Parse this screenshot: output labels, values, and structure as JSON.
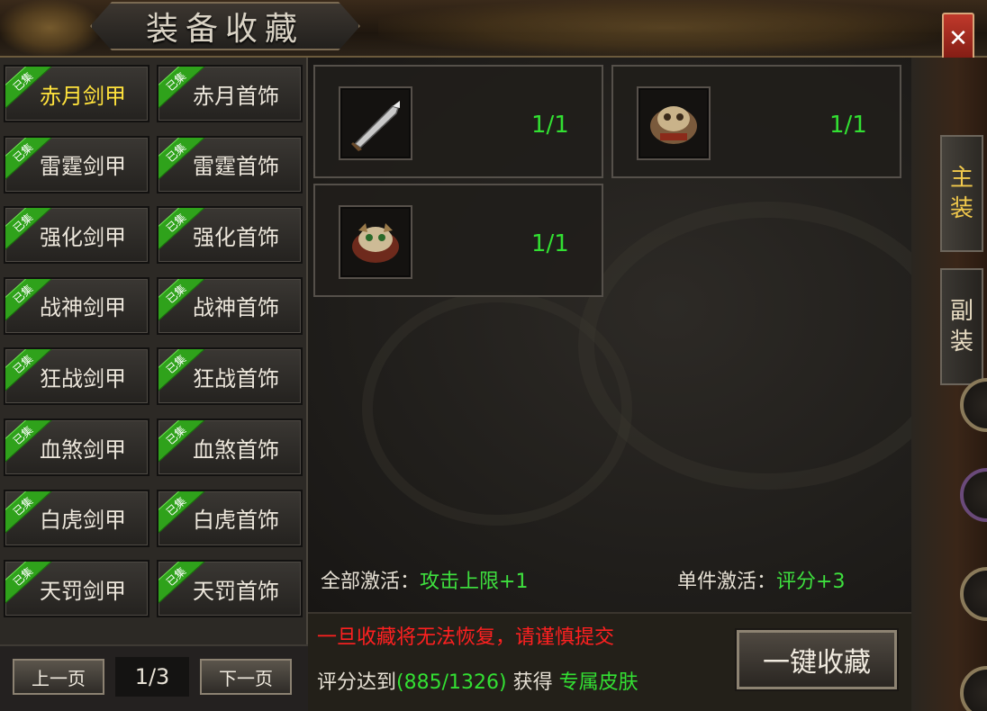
{
  "window": {
    "title": "装备收藏",
    "close_label": "✕"
  },
  "side_tabs": [
    {
      "label": "主装",
      "active": true
    },
    {
      "label": "副装",
      "active": false
    }
  ],
  "items": [
    {
      "name": "赤月剑甲",
      "tag": "已集",
      "active": true
    },
    {
      "name": "赤月首饰",
      "tag": "已集",
      "active": false
    },
    {
      "name": "雷霆剑甲",
      "tag": "已集",
      "active": false
    },
    {
      "name": "雷霆首饰",
      "tag": "已集",
      "active": false
    },
    {
      "name": "强化剑甲",
      "tag": "已集",
      "active": false
    },
    {
      "name": "强化首饰",
      "tag": "已集",
      "active": false
    },
    {
      "name": "战神剑甲",
      "tag": "已集",
      "active": false
    },
    {
      "name": "战神首饰",
      "tag": "已集",
      "active": false
    },
    {
      "name": "狂战剑甲",
      "tag": "已集",
      "active": false
    },
    {
      "name": "狂战首饰",
      "tag": "已集",
      "active": false
    },
    {
      "name": "血煞剑甲",
      "tag": "已集",
      "active": false
    },
    {
      "name": "血煞首饰",
      "tag": "已集",
      "active": false
    },
    {
      "name": "白虎剑甲",
      "tag": "已集",
      "active": false
    },
    {
      "name": "白虎首饰",
      "tag": "已集",
      "active": false
    },
    {
      "name": "天罚剑甲",
      "tag": "已集",
      "active": false
    },
    {
      "name": "天罚首饰",
      "tag": "已集",
      "active": false
    }
  ],
  "pager": {
    "prev_label": "上一页",
    "page": "1/3",
    "next_label": "下一页"
  },
  "slots": [
    {
      "icon": "sword-icon",
      "count": "1/1"
    },
    {
      "icon": "armor-icon",
      "count": "1/1"
    },
    {
      "icon": "armor-icon",
      "count": "1/1"
    }
  ],
  "bonus": {
    "all_label": "全部激活：",
    "all_value": "攻击上限+1",
    "single_label": "单件激活：",
    "single_value": "评分+3"
  },
  "warning": "一旦收藏将无法恢复，请谨慎提交",
  "score": {
    "prefix": "评分达到",
    "value": "(885/1326)",
    "middle": "获得",
    "reward": "专属皮肤"
  },
  "collect_button": "一键收藏",
  "colors": {
    "active_item": "#ffe23c",
    "count": "#32e032",
    "warning": "#ff2020",
    "tag": "#2fa21b"
  }
}
